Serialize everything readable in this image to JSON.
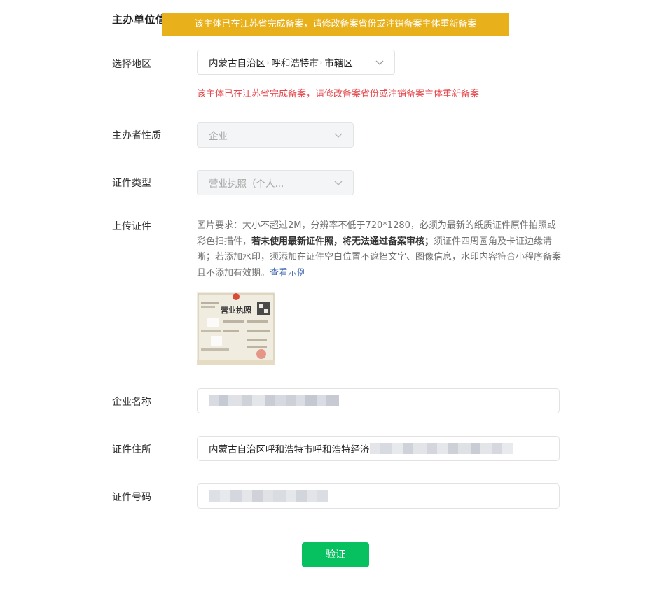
{
  "section": {
    "title": "主办单位信息"
  },
  "toast": {
    "message": "该主体已在江苏省完成备案，请修改备案省份或注销备案主体重新备案"
  },
  "region": {
    "label": "选择地区",
    "province": "内蒙古自治区",
    "city": "呼和浩特市",
    "district": "市辖区",
    "separator": "›",
    "error": "该主体已在江苏省完成备案，请修改备案省份或注销备案主体重新备案"
  },
  "organizer_type": {
    "label": "主办者性质",
    "value": "企业"
  },
  "cert_type": {
    "label": "证件类型",
    "value": "营业执照（个人..."
  },
  "upload": {
    "label": "上传证件",
    "desc_part1": "图片要求：大小不超过2M，分辨率不低于720*1280，必须为最新的纸质证件原件拍照或彩色扫描件，",
    "desc_bold": "若未使用最新证件照，将无法通过备案审核；",
    "desc_part2": "须证件四周圆角及卡证边缘清晰；若添加水印，须添加在证件空白位置不遮挡文字、图像信息，水印内容符合小程序备案且不添加有效期。",
    "example_link": "查看示例",
    "thumbnail_title": "营业执照"
  },
  "company_name": {
    "label": "企业名称",
    "value": ""
  },
  "cert_address": {
    "label": "证件住所",
    "value": "内蒙古自治区呼和浩特市呼和浩特经济"
  },
  "cert_number": {
    "label": "证件号码",
    "value": ""
  },
  "actions": {
    "verify_label": "验证"
  },
  "colors": {
    "primary": "#07c160",
    "error": "#e5484d",
    "toast": "#e8b01a",
    "link": "#4a6fb5"
  }
}
